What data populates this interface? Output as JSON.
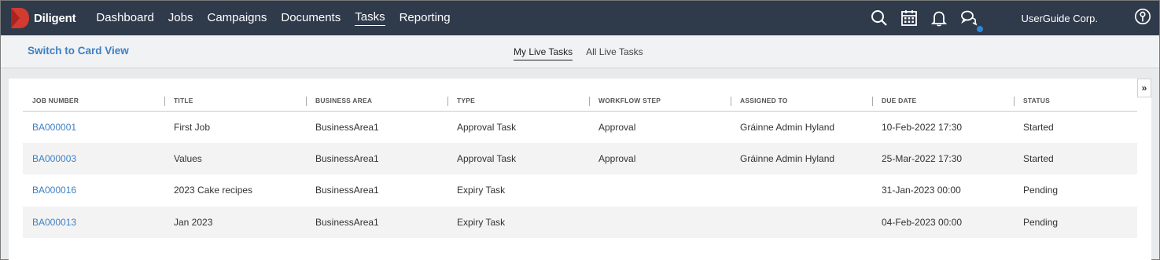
{
  "app": {
    "name": "Diligent"
  },
  "nav": {
    "items": [
      {
        "label": "Dashboard"
      },
      {
        "label": "Jobs"
      },
      {
        "label": "Campaigns"
      },
      {
        "label": "Documents"
      },
      {
        "label": "Tasks"
      },
      {
        "label": "Reporting"
      }
    ],
    "active": "Tasks"
  },
  "header": {
    "icons": [
      "search-icon",
      "calendar-icon",
      "bell-icon",
      "chat-icon",
      "user-icon"
    ],
    "company": "UserGuide Corp."
  },
  "subbar": {
    "switch_label": "Switch to Card View",
    "tabs": [
      {
        "label": "My Live Tasks"
      },
      {
        "label": "All Live Tasks"
      }
    ],
    "active_tab": "My Live Tasks"
  },
  "table": {
    "columns": [
      "JOB NUMBER",
      "TITLE",
      "BUSINESS AREA",
      "TYPE",
      "WORKFLOW STEP",
      "ASSIGNED TO",
      "DUE DATE",
      "STATUS"
    ],
    "rows": [
      [
        "BA000001",
        "First Job",
        "BusinessArea1",
        "Approval Task",
        "Approval",
        "Gráinne Admin Hyland",
        "10-Feb-2022 17:30",
        "Started"
      ],
      [
        "BA000003",
        "Values",
        "BusinessArea1",
        "Approval Task",
        "Approval",
        "Gráinne Admin Hyland",
        "25-Mar-2022 17:30",
        "Started"
      ],
      [
        "BA000016",
        "2023 Cake recipes",
        "BusinessArea1",
        "Expiry Task",
        "",
        "",
        "31-Jan-2023 00:00",
        "Pending"
      ],
      [
        "BA000013",
        "Jan 2023",
        "BusinessArea1",
        "Expiry Task",
        "",
        "",
        "04-Feb-2023 00:00",
        "Pending"
      ]
    ]
  },
  "panel": {
    "collapse_label": "»"
  },
  "colors": {
    "topbar": "#2f3a4b",
    "link": "#3d80c4",
    "brand_red": "#d23b2f",
    "notification_dot": "#2e86d6"
  }
}
